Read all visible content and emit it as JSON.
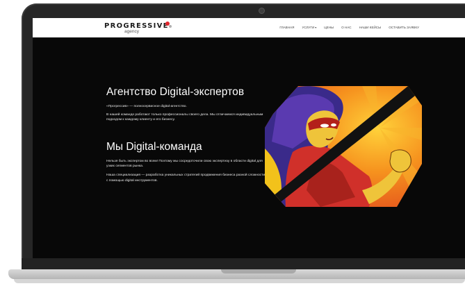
{
  "logo": {
    "main": "PROGRESSIVE",
    "sub": "agency"
  },
  "nav": [
    {
      "label": "Главная"
    },
    {
      "label": "Услуги",
      "has_caret": true
    },
    {
      "label": "Цены"
    },
    {
      "label": "О нас"
    },
    {
      "label": "Наши кейсы"
    },
    {
      "label": "Оставить заявку"
    }
  ],
  "hero": {
    "title": "Агентство Digital-экспертов",
    "p1": "«Прогрессив» — полносервисное digital-агентство.",
    "p2": "В нашей команде работают только профессионалы своего дела. Мы отличаемся индивидуальным подходом к каждому клиенту и его бизнесу.",
    "subtitle": "Мы Digital-команда",
    "p3": "Нельзя быть экспертом во всем! Поэтому мы сосредоточили свою экспертизу в области digital для узких сегментов рынка.",
    "p4": "Наша специализация — разработка уникальных стратегий продвижения бизнеса разной сложности с помощью digital инструментов."
  },
  "icons": {
    "caret": "▾"
  },
  "colors": {
    "accent": "#e1262d",
    "screen_bg": "#080808",
    "art_orange": "#f08a17",
    "art_red": "#d62b20"
  }
}
